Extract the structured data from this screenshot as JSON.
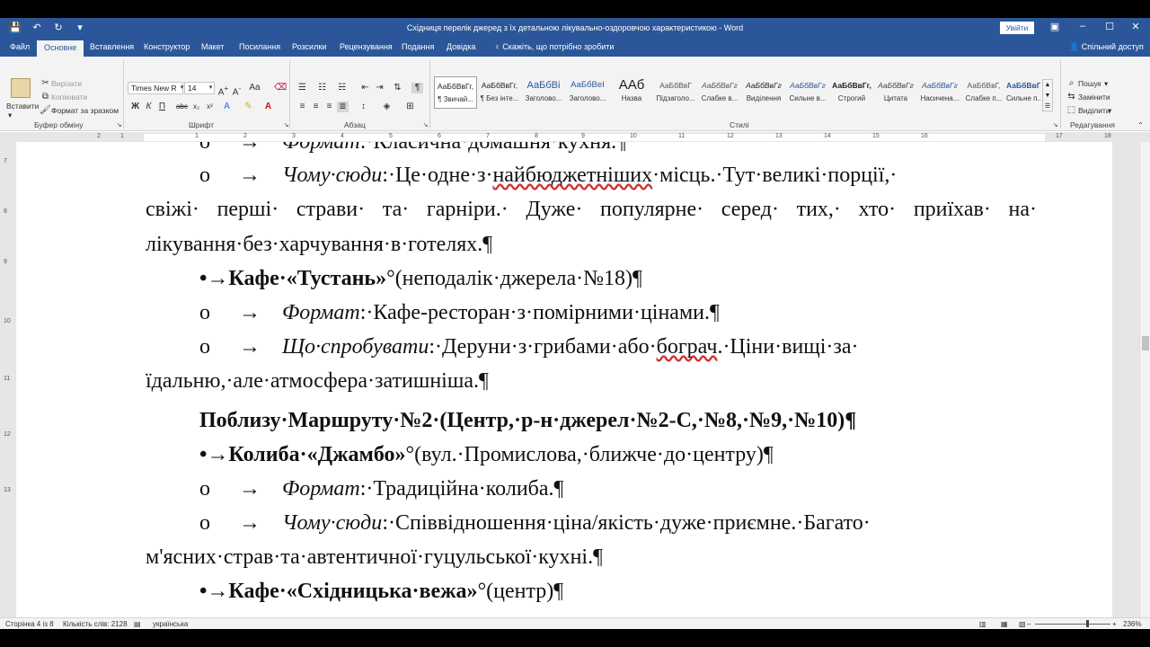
{
  "titlebar": {
    "title": "Східниця перелік джеред з їх детальною лікувально-оздоровчою характеристикою  -  Word",
    "signin": "Увійти",
    "qat": [
      "💾",
      "↶",
      "↻",
      "▾"
    ]
  },
  "tabs": [
    "Файл",
    "Основне",
    "Вставлення",
    "Конструктор",
    "Макет",
    "Посилання",
    "Розсилки",
    "Рецензування",
    "Подання",
    "Довідка"
  ],
  "tell_me": "Скажіть, що потрібно зробити",
  "share": "Спільний доступ",
  "ribbon": {
    "clipboard": {
      "paste": "Вставити",
      "cut": "Вирізати",
      "copy": "Копіювати",
      "format_painter": "Формат за зразком",
      "label": "Буфер обміну"
    },
    "font": {
      "name": "Times New R",
      "size": "14",
      "label": "Шрифт"
    },
    "paragraph": {
      "label": "Абзац"
    },
    "styles": {
      "label": "Стилі",
      "items": [
        {
          "preview": "АаБбВвГг,",
          "name": "¶ Звичай..."
        },
        {
          "preview": "АаБбВвГг,",
          "name": "¶ Без інте..."
        },
        {
          "preview": "АаБбВі",
          "name": "Заголово..."
        },
        {
          "preview": "АаБбВеІ",
          "name": "Заголово..."
        },
        {
          "preview": "ААб",
          "name": "Назва"
        },
        {
          "preview": "АаБбВвГ",
          "name": "Підзаголо..."
        },
        {
          "preview": "АаБбВвГг",
          "name": "Слабке в..."
        },
        {
          "preview": "АаБбВвГг",
          "name": "Виділення"
        },
        {
          "preview": "АаБбВвГг",
          "name": "Сильне в..."
        },
        {
          "preview": "АаБбВвГг,",
          "name": "Строгий"
        },
        {
          "preview": "АаБбВвГг",
          "name": "Цитата"
        },
        {
          "preview": "АаБбВвГг",
          "name": "Насичена..."
        },
        {
          "preview": "АаБбВвГ,",
          "name": "Слабке п..."
        },
        {
          "preview": "АаБбВвГ,",
          "name": "Сильне п..."
        }
      ]
    },
    "editing": {
      "find": "Пошук",
      "replace": "Замінити",
      "select": "Виділити",
      "label": "Редагування"
    }
  },
  "ruler_numbers": [
    "2",
    "1",
    "1",
    "2",
    "3",
    "4",
    "5",
    "6",
    "7",
    "8",
    "9",
    "10",
    "11",
    "12",
    "13",
    "14",
    "15",
    "16",
    "17",
    "18"
  ],
  "vruler_numbers": [
    "7",
    "8",
    "9",
    "10",
    "11",
    "12",
    "13"
  ],
  "document": {
    "l1": {
      "bullet": "o",
      "arrow": "→",
      "label": "Формат",
      "text": ":·Класична·домашня·кухня.¶"
    },
    "l2": {
      "bullet": "o",
      "arrow": "→",
      "label": "Чому·сюди",
      "t1": ":·Це·одне·з·",
      "sq": "найбюджетніших",
      "t2": "·місць.·Тут·великі·порції,·"
    },
    "l3": [
      "свіжі·",
      "перші·",
      "страви·",
      "та·",
      "гарніри.·",
      "Дуже·",
      "популярне·",
      "серед·",
      "тих,·",
      "хто·",
      "приїхав·",
      "на·"
    ],
    "l4": "лікування·без·харчування·в·готелях.¶",
    "l5": {
      "bullet": "•→",
      "title": "Кафе·«Тустань»",
      "text": "°(неподалік·джерела·№18)¶"
    },
    "l6": {
      "bullet": "o",
      "arrow": "→",
      "label": "Формат",
      "text": ":·Кафе-ресторан·з·помірними·цінами.¶"
    },
    "l7": {
      "bullet": "o",
      "arrow": "→",
      "label": "Що·спробувати",
      "t1": ":·Деруни·з·грибами·або·",
      "sq": "бограч",
      "t2": ".·Ціни·вищі·за·"
    },
    "l8": "їдальню,·але·атмосфера·затишніша.¶",
    "l9": "Поблизу·Маршруту·№2·(Центр,·р-н·джерел·№2-С,·№8,·№9,·№10)¶",
    "l10": {
      "bullet": "•→",
      "title": "Колиба·«Джамбо»",
      "text": "°(вул.·Промислова,·ближче·до·центру)¶"
    },
    "l11": {
      "bullet": "o",
      "arrow": "→",
      "label": "Формат",
      "text": ":·Традиційна·колиба.¶"
    },
    "l12": {
      "bullet": "o",
      "arrow": "→",
      "label": "Чому·сюди",
      "t1": ":·Співвідношення·ціна/якість·дуже·приємне.·Багато·"
    },
    "l13": "м'ясних·страв·та·автентичної·гуцульської·кухні.¶",
    "l14": {
      "bullet": "•→",
      "title": "Кафе·«Східницька·вежа»",
      "text": "°(центр)¶"
    }
  },
  "status": {
    "page": "Сторінка 4 із 8",
    "words": "Кількість слів: 2128",
    "lang": "українська",
    "zoom": "236%"
  }
}
